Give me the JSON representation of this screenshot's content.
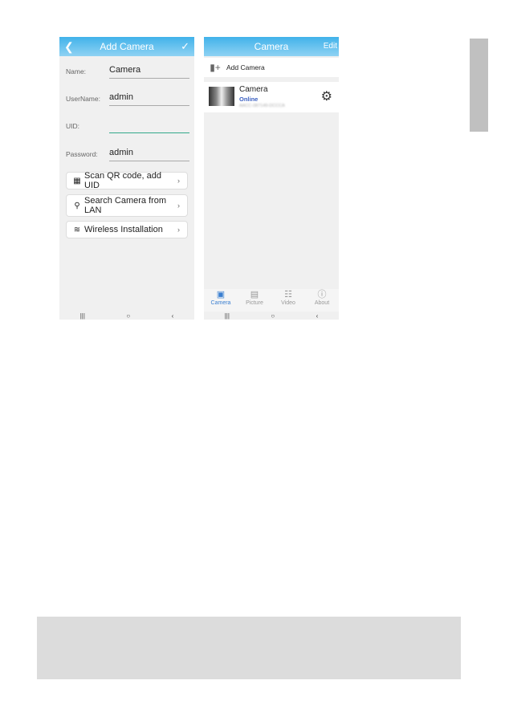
{
  "left_screen": {
    "title": "Add Camera",
    "back_icon": "chevron-left-icon",
    "confirm_icon": "checkmark-icon",
    "fields": [
      {
        "label": "Name:",
        "value": "Camera"
      },
      {
        "label": "UserName:",
        "value": "admin"
      },
      {
        "label": "UID:",
        "value": ""
      },
      {
        "label": "Password:",
        "value": "admin"
      }
    ],
    "buttons": [
      {
        "icon": "qr-code-icon",
        "label": "Scan QR code, add UID"
      },
      {
        "icon": "search-icon",
        "label": "Search Camera from LAN"
      },
      {
        "icon": "wifi-icon",
        "label": "Wireless Installation"
      }
    ]
  },
  "right_screen": {
    "title": "Camera",
    "edit_label": "Edit",
    "add_camera_label": "Add Camera",
    "camera": {
      "name": "Camera",
      "status": "Online",
      "uid": "AACC-087149-DCCCA"
    },
    "tabs": [
      {
        "icon": "camera-icon",
        "label": "Camera",
        "selected": true
      },
      {
        "icon": "picture-icon",
        "label": "Picture",
        "selected": false
      },
      {
        "icon": "video-icon",
        "label": "Video",
        "selected": false
      },
      {
        "icon": "info-icon",
        "label": "About",
        "selected": false
      }
    ]
  },
  "android_nav": {
    "recent": "|||",
    "home": "○",
    "back": "‹"
  },
  "colors": {
    "header": "#41b2ea",
    "online": "#3a5fc0",
    "uid_underline": "#33a88a",
    "tab_selected": "#3a7fd0"
  }
}
